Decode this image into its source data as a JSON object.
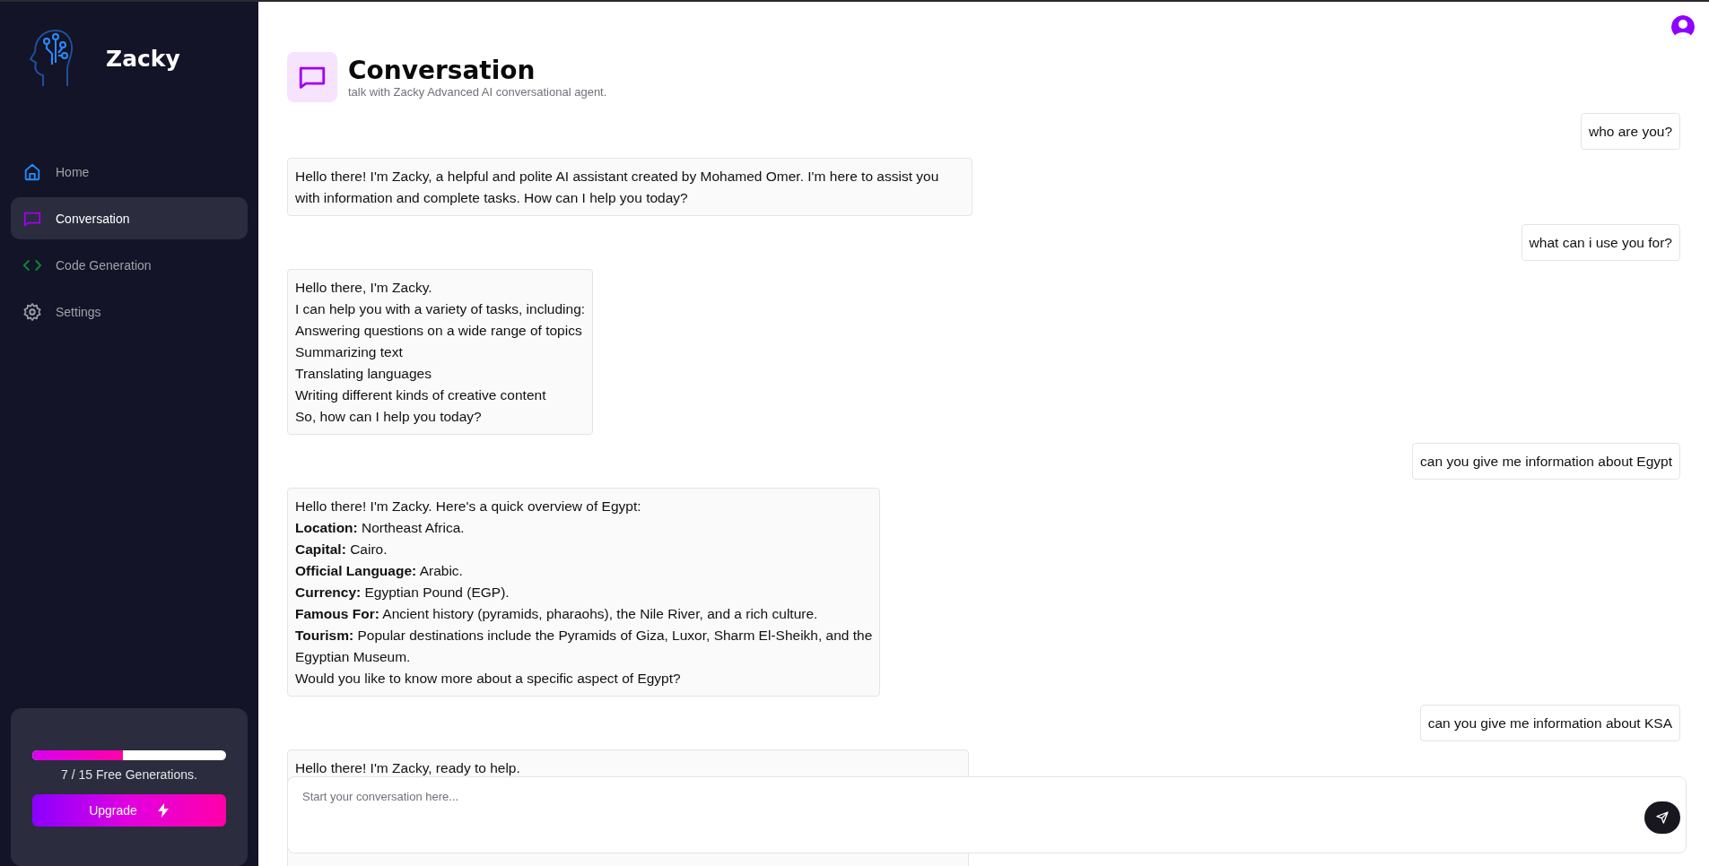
{
  "sidebar": {
    "brand": "Zacky",
    "items": [
      {
        "label": "Home",
        "selected": false
      },
      {
        "label": "Conversation",
        "selected": true
      },
      {
        "label": "Code Generation",
        "selected": false
      },
      {
        "label": "Settings",
        "selected": false
      }
    ],
    "usage": {
      "level": 0.467,
      "text": "7 / 15 Free Generations.",
      "button": "Upgrade"
    }
  },
  "header": {
    "title": "Conversation",
    "subtitle": "talk with Zacky Advanced AI conversational agent."
  },
  "messages": [
    {
      "kind": "user",
      "lines": [
        "who are you?"
      ]
    },
    {
      "kind": "bot",
      "lines": [
        "Hello there! I'm Zacky, a helpful and polite AI assistant created by Mohamed Omer. I'm here to assist you with information and complete tasks. How can I help you today?"
      ]
    },
    {
      "kind": "user",
      "lines": [
        "what can i use you for?"
      ]
    },
    {
      "kind": "bot",
      "lines": [
        "Hello there, I'm Zacky.",
        "I can help you with a variety of tasks, including:",
        "Answering questions on a wide range of topics",
        "Summarizing text",
        "Translating languages",
        "Writing different kinds of creative content",
        "So, how can I help you today?"
      ]
    },
    {
      "kind": "user",
      "lines": [
        "can you give me information about Egypt"
      ]
    },
    {
      "kind": "bot",
      "lines": [
        "Hello there! I'm Zacky. Here's a quick overview of Egypt:",
        "**Location:** Northeast Africa.",
        "**Capital:** Cairo.",
        "**Official Language:** Arabic.",
        "**Currency:** Egyptian Pound (EGP).",
        "**Famous For:** Ancient history (pyramids, pharaohs), the Nile River, and a rich culture.",
        "**Tourism:** Popular destinations include the Pyramids of Giza, Luxor, Sharm El-Sheikh, and the",
        "Egyptian Museum.",
        "Would you like to know more about a specific aspect of Egypt?"
      ]
    },
    {
      "kind": "user",
      "lines": [
        "can you give me information about KSA"
      ]
    },
    {
      "kind": "bot",
      "lines": [
        "Hello there! I'm Zacky, ready to help."
      ]
    }
  ],
  "composer": {
    "placeholder": "Start your conversation here..."
  }
}
